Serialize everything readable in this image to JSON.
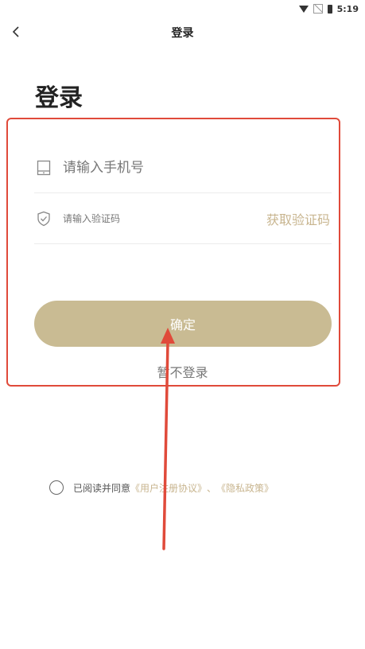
{
  "status_bar": {
    "time": "5:19",
    "icons": [
      "wifi-icon",
      "no-sim-icon",
      "battery-icon"
    ]
  },
  "nav": {
    "back_icon": "chevron-left-icon",
    "title": "登录"
  },
  "page": {
    "heading": "登录"
  },
  "form": {
    "phone": {
      "icon": "phone-icon",
      "placeholder": "请输入手机号",
      "value": ""
    },
    "code": {
      "icon": "shield-check-icon",
      "placeholder": "请输入验证码",
      "value": "",
      "get_code_label": "获取验证码"
    },
    "confirm_label": "确定",
    "skip_label": "暂不登录"
  },
  "agreement": {
    "prefix": "已阅读并同意",
    "user_agreement": "《用户注册协议》",
    "separator": "、",
    "privacy_policy": "《隐私政策》"
  },
  "colors": {
    "accent": "#c9bb93",
    "accent_text": "#c8b58f",
    "highlight_border": "#e04a3a",
    "arrow": "#e04a3a"
  }
}
